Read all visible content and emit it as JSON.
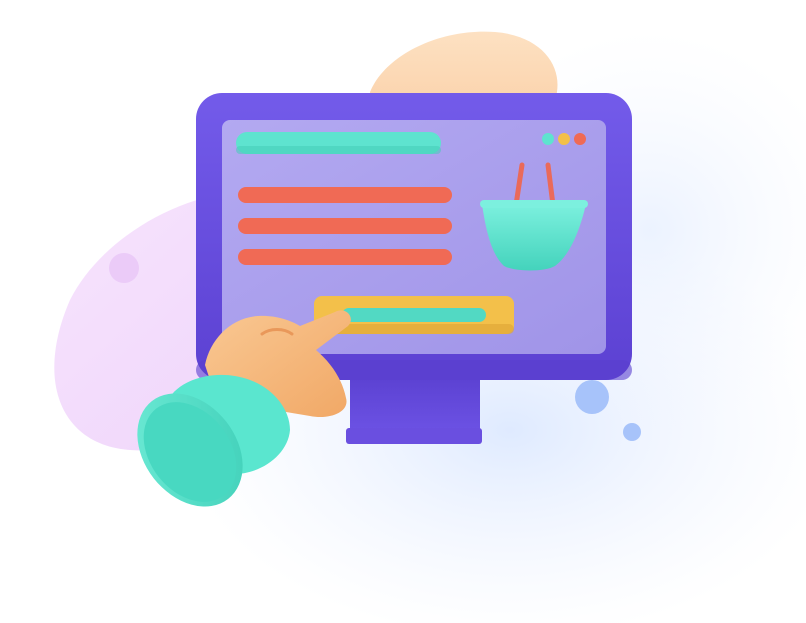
{
  "illustration": {
    "subject": "online-shopping",
    "icons": [
      "monitor-icon",
      "shopping-basket-icon",
      "pointing-hand-icon"
    ],
    "colors": {
      "monitor_frame": "#6A4FE0",
      "monitor_frame_dark": "#5A3FCF",
      "screen": "#A79CEB",
      "screen_light": "#B2A8F0",
      "title_bar": "#5EE3CF",
      "text_lines": "#F06A55",
      "cta_button": "#F3C04A",
      "cta_bar": "#52D9C3",
      "basket": "#63E6D2",
      "basket_handles": "#EA6A5A",
      "dot_teal": "#5EE3CF",
      "dot_yellow": "#F3C04A",
      "dot_red": "#F06A55",
      "hand": "#F6B77A",
      "sleeve": "#4FE0C8",
      "blob_peach": "#FDDCB8",
      "blob_violet": "#F2D8FA",
      "glow_blue": "#DDE9FF",
      "bubble_blue": "#A7C3FA"
    }
  }
}
